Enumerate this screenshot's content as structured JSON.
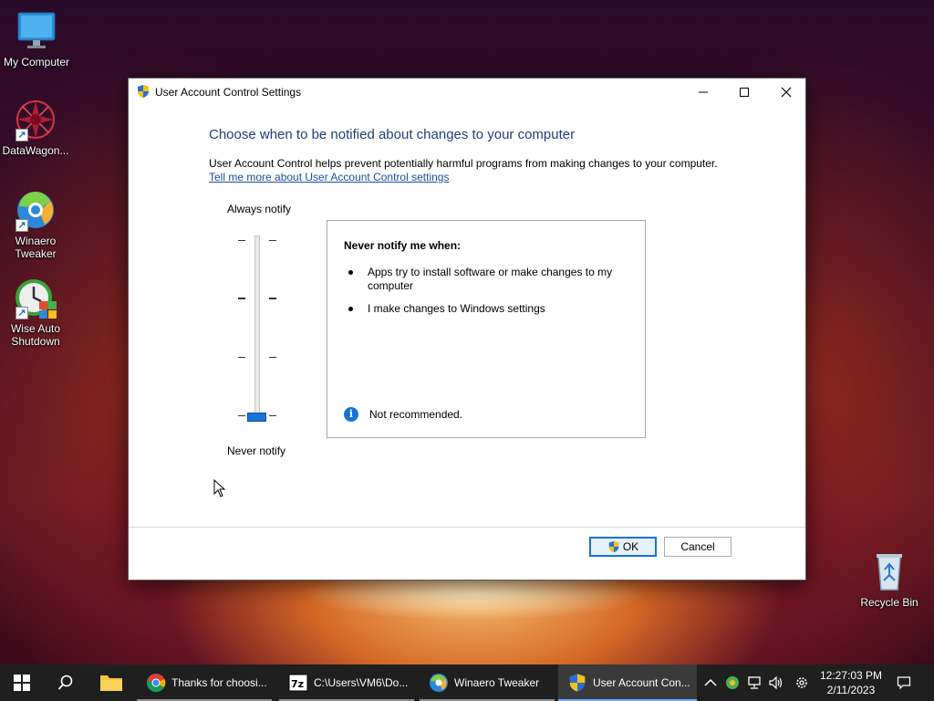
{
  "desktop": {
    "icons": [
      {
        "label": "My Computer"
      },
      {
        "label": "DataWagon..."
      },
      {
        "label": "Winaero Tweaker"
      },
      {
        "label": "Wise Auto Shutdown"
      },
      {
        "label": "Recycle Bin"
      }
    ]
  },
  "window": {
    "title": "User Account Control Settings",
    "heading": "Choose when to be notified about changes to your computer",
    "description": "User Account Control helps prevent potentially harmful programs from making changes to your computer.",
    "learn_more_link": "Tell me more about User Account Control settings",
    "slider": {
      "top_label": "Always notify",
      "bottom_label": "Never notify",
      "levels": 4,
      "selected_level": 1
    },
    "info_box": {
      "title": "Never notify me when:",
      "bullets": [
        "Apps try to install software or make changes to my computer",
        "I make changes to Windows settings"
      ],
      "note": "Not recommended."
    },
    "buttons": {
      "ok": "OK",
      "cancel": "Cancel"
    }
  },
  "taskbar": {
    "apps": [
      {
        "label": "Thanks for choosi..."
      },
      {
        "label": "C:\\Users\\VM6\\Do..."
      },
      {
        "label": "Winaero Tweaker"
      },
      {
        "label": "User Account Con..."
      }
    ],
    "clock": {
      "time": "12:27:03 PM",
      "date": "2/11/2023"
    }
  },
  "colors": {
    "accent": "#1a73d4",
    "heading": "#1e3f7a",
    "link": "#1a4e9c",
    "taskbar": "#1f1f1f"
  }
}
